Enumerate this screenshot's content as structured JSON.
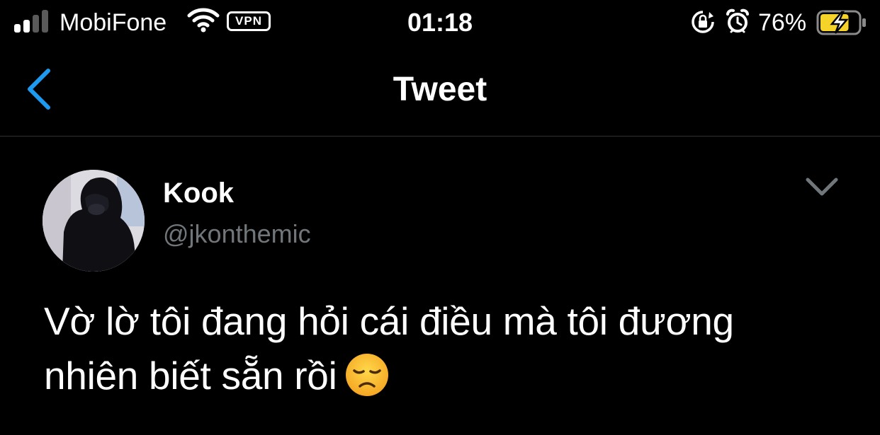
{
  "status_bar": {
    "carrier": "MobiFone",
    "vpn_label": "VPN",
    "time": "01:18",
    "battery_percent": "76%",
    "battery_level": 0.76,
    "charging": true,
    "icons": [
      "signal-icon",
      "wifi-icon",
      "rotation-lock-icon",
      "alarm-icon",
      "battery-charging-icon"
    ]
  },
  "nav": {
    "title": "Tweet",
    "back_icon": "chevron-left-icon"
  },
  "tweet": {
    "author_name": "Kook",
    "author_handle": "@jkonthemic",
    "text": "Vờ lờ tôi đang hỏi cái điều mà tôi đương nhiên biết sẵn rồi",
    "emoji": "disappointed-face-emoji",
    "menu_icon": "chevron-down-icon"
  },
  "colors": {
    "background": "#000000",
    "accent": "#1d9bf0",
    "text_primary": "#ffffff",
    "text_secondary": "#71767b",
    "battery_fill": "#f5d328",
    "divider": "#2f3336"
  }
}
